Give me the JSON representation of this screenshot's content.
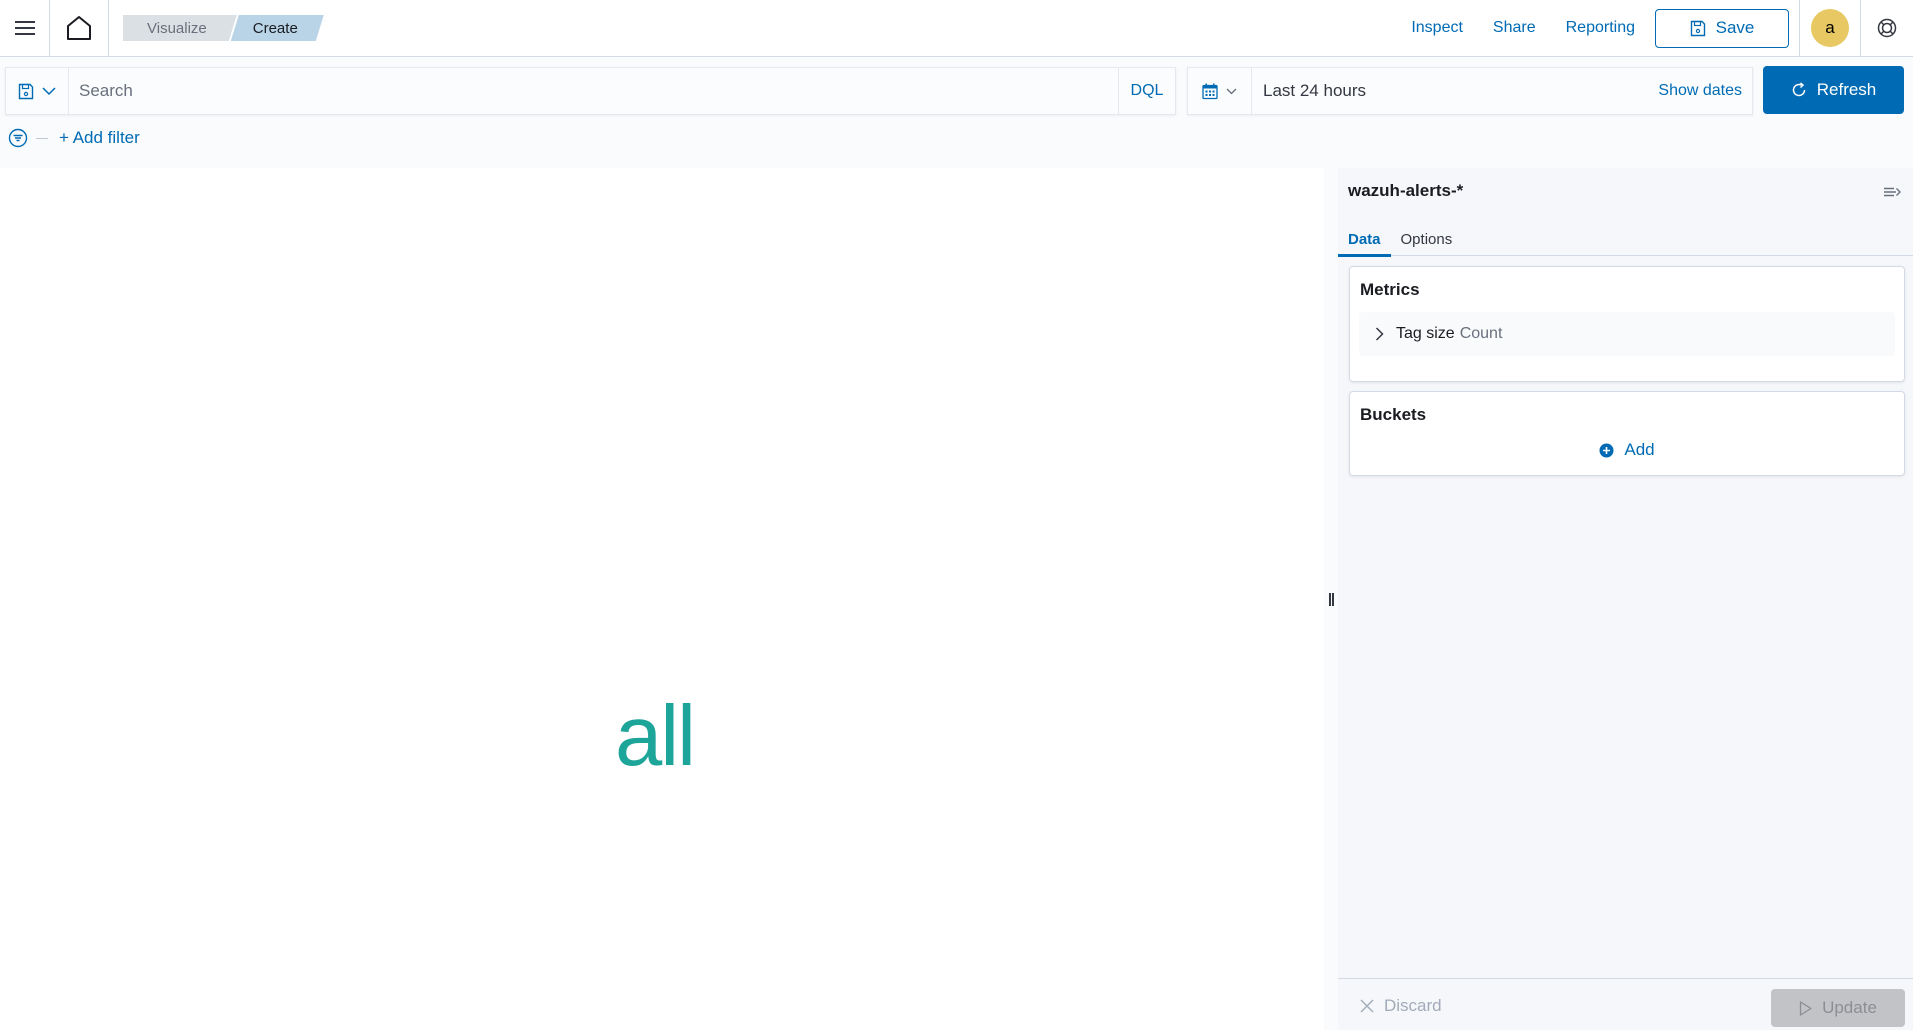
{
  "topbar": {
    "breadcrumbs": [
      "Visualize",
      "Create"
    ],
    "links": {
      "inspect": "Inspect",
      "share": "Share",
      "reporting": "Reporting"
    },
    "save_label": "Save",
    "avatar_initial": "a"
  },
  "query": {
    "search_placeholder": "Search",
    "search_value": "",
    "language": "DQL"
  },
  "date": {
    "range": "Last 24 hours",
    "show_dates": "Show dates",
    "refresh_label": "Refresh"
  },
  "filters": {
    "add_filter": "+ Add filter"
  },
  "visualization": {
    "words": [
      "all"
    ],
    "word_color": "#1ea59a"
  },
  "sidebar": {
    "index_pattern": "wazuh-alerts-*",
    "tabs": [
      {
        "label": "Data",
        "active": true
      },
      {
        "label": "Options",
        "active": false
      }
    ],
    "metrics": {
      "title": "Metrics",
      "items": [
        {
          "label": "Tag size",
          "aggregation": "Count"
        }
      ]
    },
    "buckets": {
      "title": "Buckets",
      "add_label": "Add"
    },
    "footer": {
      "discard_label": "Discard",
      "update_label": "Update"
    }
  },
  "colors": {
    "accent": "#006bb4",
    "avatar": "#e7c862"
  }
}
